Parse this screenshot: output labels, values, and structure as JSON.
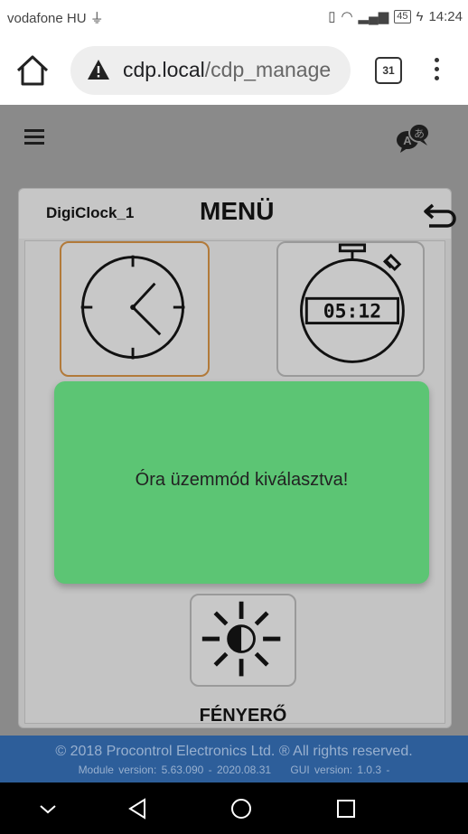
{
  "status_bar": {
    "carrier": "vodafone HU",
    "battery": "45",
    "time": "14:24"
  },
  "browser": {
    "url_host": "cdp.local",
    "url_path": "/cdp_manage",
    "tab_count": "31"
  },
  "app": {
    "device_name": "DigiClock_1",
    "menu_title": "MENÜ",
    "tiles": [
      {
        "name": "clock-mode",
        "icon": "clock-icon",
        "selected": true
      },
      {
        "name": "stopwatch-mode",
        "icon": "stopwatch-icon",
        "display": "05:12",
        "selected": false
      },
      {
        "name": "brightness",
        "icon": "brightness-icon",
        "label": "FÉNYERŐ",
        "selected": false
      }
    ],
    "toast": "Óra üzemmód kiválasztva!",
    "colors": {
      "app_background": "#8a8a8a",
      "toast": "#5cc574",
      "footer": "#2d5e9a",
      "selected_border": "#b27a3a"
    }
  },
  "footer": {
    "copyright": "© 2018 Procontrol Electronics Ltd. ® All rights reserved.",
    "module_version": "Module version: 5.63.090 - 2020.08.31",
    "gui_version": "GUI version: 1.0.3 -"
  }
}
